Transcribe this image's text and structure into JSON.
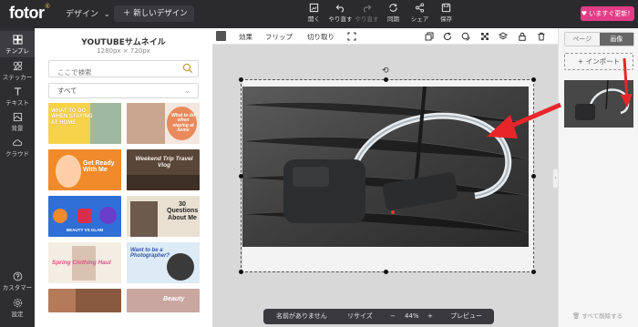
{
  "topbar": {
    "logo": "fotor",
    "logo_mark": "®",
    "design_menu": "デザイン",
    "new_design": "＋ 新しいデザイン",
    "tools": [
      {
        "label": "開く",
        "icon": "open-icon"
      },
      {
        "label": "やり直す",
        "icon": "undo-icon"
      },
      {
        "label": "やり直す",
        "icon": "redo-icon"
      },
      {
        "label": "同期",
        "icon": "sync-icon"
      },
      {
        "label": "シェア",
        "icon": "share-icon"
      },
      {
        "label": "保存",
        "icon": "save-icon"
      }
    ],
    "upgrade": "いますぐ更新！"
  },
  "leftrail": {
    "items": [
      {
        "label": "テンプレ",
        "icon": "template-icon"
      },
      {
        "label": "ステッカー",
        "icon": "sticker-icon"
      },
      {
        "label": "テキスト",
        "icon": "text-icon"
      },
      {
        "label": "背景",
        "icon": "background-icon"
      },
      {
        "label": "クラウド",
        "icon": "cloud-icon"
      },
      {
        "label": "カスタマー",
        "icon": "help-icon"
      },
      {
        "label": "設定",
        "icon": "settings-icon"
      }
    ]
  },
  "panel": {
    "title": "YOUTUBEサムネイル",
    "subtitle": "1280px × 720px",
    "search_placeholder": "ここで検索",
    "filter": "すべて",
    "thumbs": [
      {
        "text": "WHAT TO DO WHEN STAYING AT HOME",
        "bg": "#f6d24a"
      },
      {
        "text": "What to do when staying at home",
        "bg": "#e98a5c"
      },
      {
        "text": "Get Ready With Me",
        "bg": "#f08a2a"
      },
      {
        "text": "Weekend Trip Travel Vlog",
        "bg": "#5a4638"
      },
      {
        "text": "BEAUTY VS GLAM",
        "bg": "#2f6fd6"
      },
      {
        "text": "30 Questions About Me",
        "bg": "#e9e0d2"
      },
      {
        "text": "Spring Clothing Haul",
        "bg": "#f3ede3"
      },
      {
        "text": "Want to be a Photographer?",
        "bg": "#dcebf5"
      },
      {
        "text": "",
        "bg": "#b47b5a"
      },
      {
        "text": "Beauty",
        "bg": "#c9a6a0"
      }
    ]
  },
  "subtoolbar": {
    "effects": "効果",
    "flip": "フリップ",
    "crop": "切り取り"
  },
  "bottombar": {
    "name": "名前がありません",
    "resize": "リサイズ",
    "minus": "−",
    "zoom": "44%",
    "plus": "+",
    "preview": "プレビュー"
  },
  "rightpanel": {
    "tab_page": "ページ",
    "tab_image": "画像",
    "import": "+ インポート",
    "delete_all": "すべて削除する"
  },
  "colors": {
    "dark": "#2b2b2e",
    "upgrade": "#e23d86",
    "arrow": "#e8262a"
  }
}
